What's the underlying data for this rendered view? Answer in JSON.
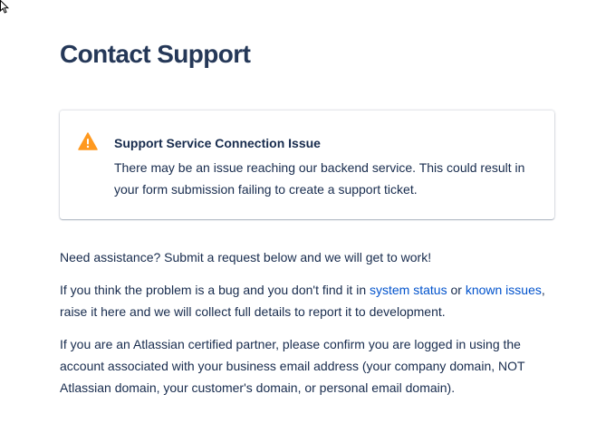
{
  "page": {
    "title": "Contact Support"
  },
  "alert": {
    "title": "Support Service Connection Issue",
    "body": "There may be an issue reaching our backend service. This could result in your form submission failing to create a support ticket.",
    "icon": "warning-icon",
    "icon_color": "#ff991f"
  },
  "intro": {
    "p1": "Need assistance? Submit a request below and we will get to work!",
    "p2_before": "If you think the problem is a bug and you don't find it in ",
    "p2_link1": "system status",
    "p2_between": " or ",
    "p2_link2": "known issues",
    "p2_after": ", raise it here and we will collect full details to report it to development.",
    "p3": "If you are an Atlassian certified partner, please confirm you are logged in using the account associated with your business email address (your company domain, NOT Atlassian domain, your customer's domain, or personal email domain)."
  },
  "colors": {
    "title": "#253858",
    "text": "#172b4d",
    "link": "#0052cc"
  }
}
